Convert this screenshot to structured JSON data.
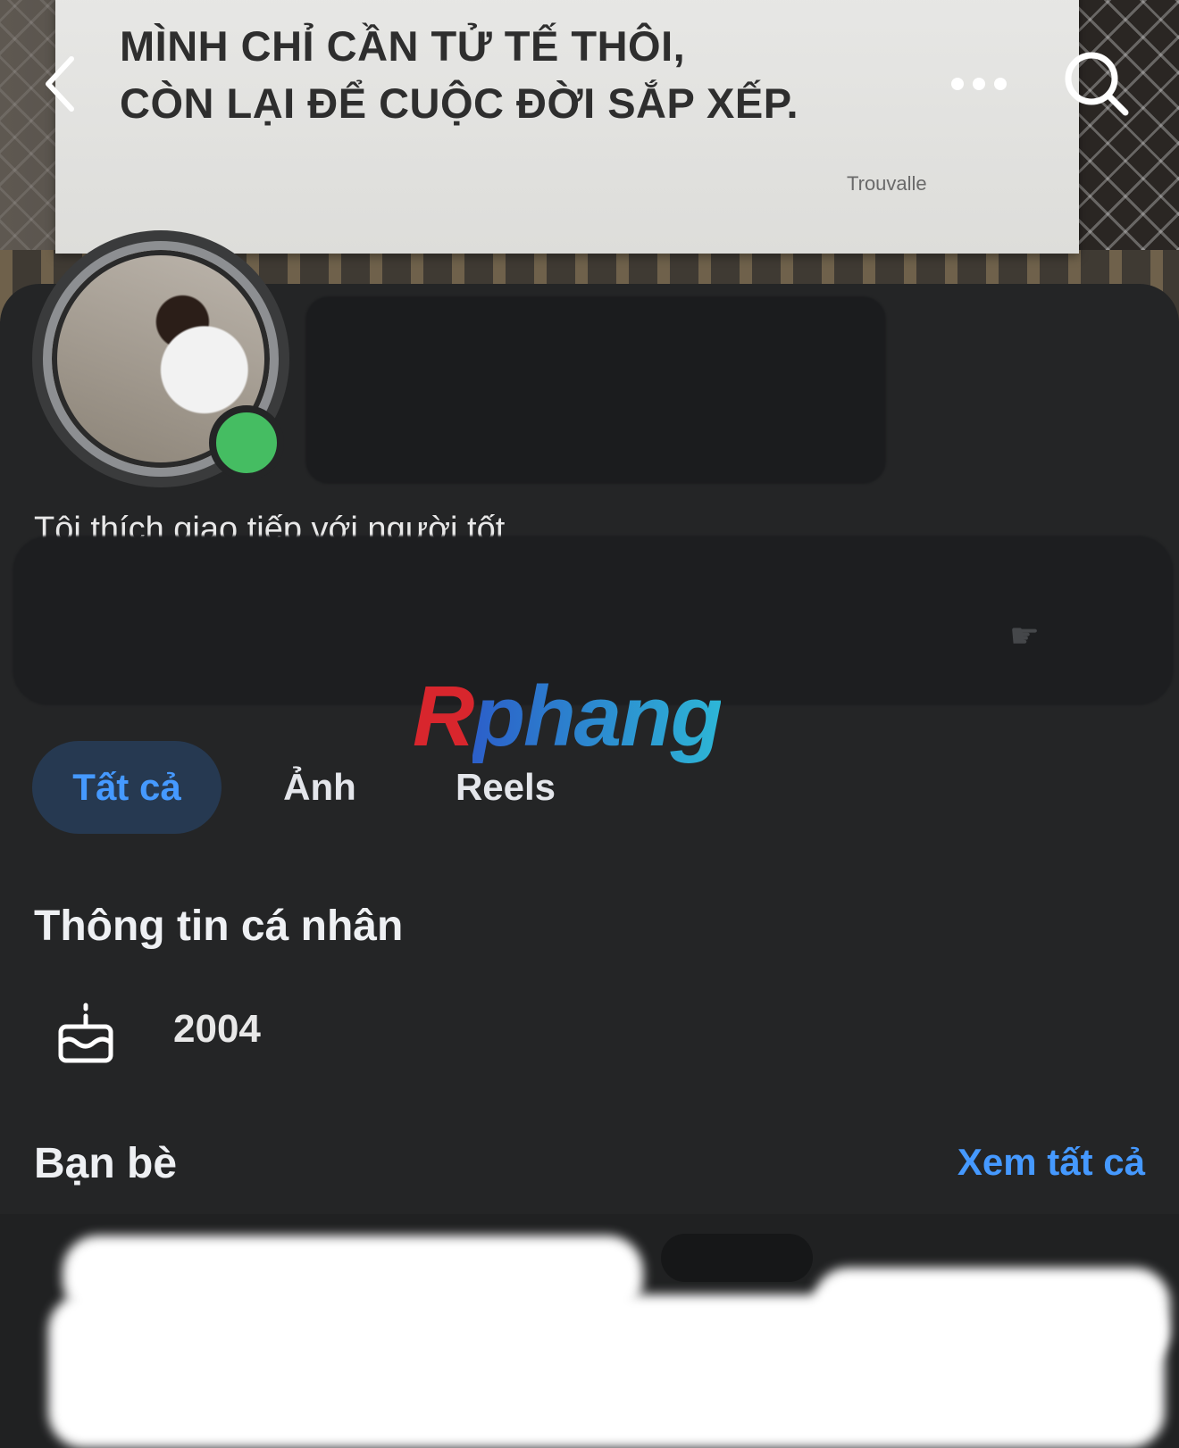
{
  "cover": {
    "banner_line_1": "MÌNH CHỈ CẦN TỬ TẾ THÔI,",
    "banner_line_2": "CÒN LẠI ĐỂ CUỘC ĐỜI SẮP XẾP.",
    "banner_brand": "Trouvalle"
  },
  "header": {
    "back_icon": "chevron-left-icon",
    "more_icon": "more-horizontal-icon",
    "search_icon": "search-icon"
  },
  "profile": {
    "bio": "Tôi thích giao tiếp với người tốt",
    "online_status_color": "#45bd62"
  },
  "watermark": {
    "first": "R",
    "rest": "phang"
  },
  "tabs": [
    {
      "label": "Tất cả",
      "selected": true
    },
    {
      "label": "Ảnh",
      "selected": false
    },
    {
      "label": "Reels",
      "selected": false
    }
  ],
  "personal_info": {
    "title": "Thông tin cá nhân",
    "birth_icon": "birthday-cake-icon",
    "birth_year": "2004"
  },
  "friends": {
    "title": "Bạn bè",
    "see_all": "Xem tất cả"
  },
  "colors": {
    "background": "#242526",
    "accent": "#4599ff",
    "selected_tab_bg": "#263951"
  }
}
